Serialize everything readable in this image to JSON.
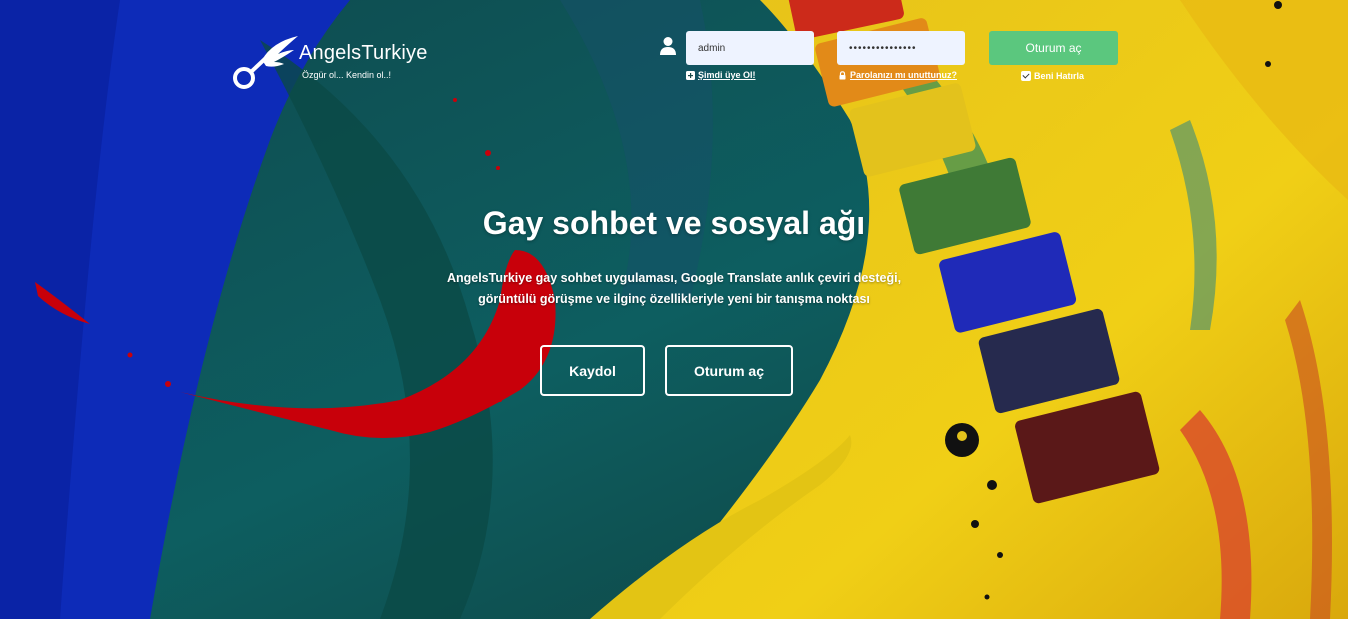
{
  "brand": {
    "name": "AngelsTurkiye",
    "tagline": "Özgür ol... Kendin ol..!"
  },
  "login": {
    "username_value": "admin",
    "password_value": "•••••••••••••••",
    "submit_label": "Oturum aç",
    "signup_link": "Şimdi üye Ol!",
    "forgot_link": "Parolanızı mı unuttunuz?",
    "remember_label": "Beni Hatırla"
  },
  "hero": {
    "title": "Gay sohbet ve sosyal ağı",
    "description_line1": "AngelsTurkiye gay sohbet uygulaması, Google Translate anlık çeviri desteği,",
    "description_line2": "görüntülü görüşme ve ilginç özellikleriyle yeni bir tanışma noktası",
    "register_label": "Kaydol",
    "login_label": "Oturum aç"
  },
  "icons": {
    "user": "user-icon",
    "plus": "plus-square-icon",
    "lock": "lock-icon",
    "check": "checkbox-icon",
    "logo": "winged-key-logo-icon"
  },
  "colors": {
    "login_button": "#5bc77e",
    "input_bg": "#eef3ff"
  }
}
